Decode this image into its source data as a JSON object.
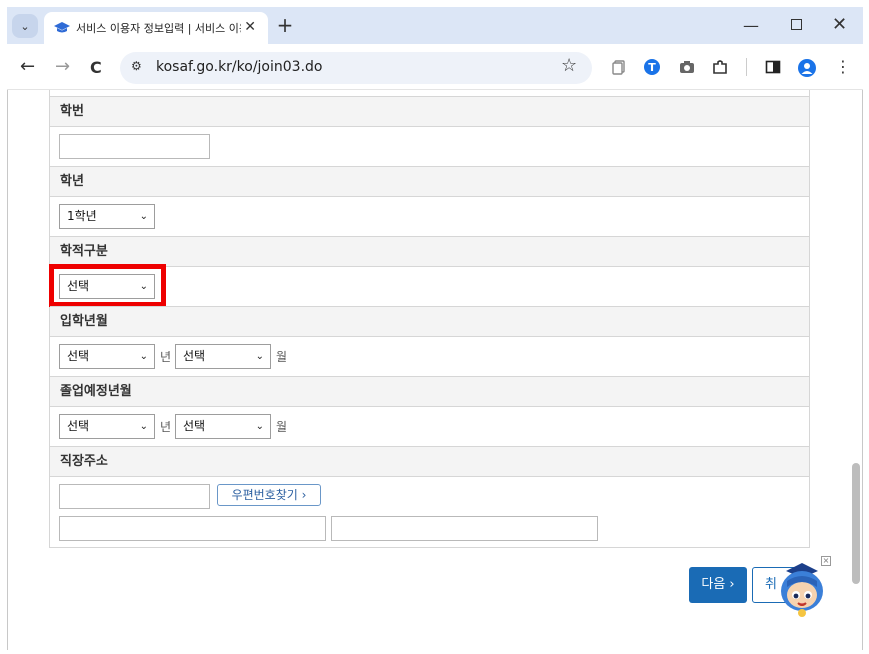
{
  "browser": {
    "tab_title": "서비스 이용자 정보입력 | 서비스 이용",
    "url": "kosaf.go.kr/ko/join03.do",
    "new_tab": "+",
    "back": "←",
    "forward": "→",
    "reload": "C",
    "minimize": "—",
    "close": "✕",
    "star": "☆",
    "tab_close": "✕",
    "tab_list": "⌄",
    "site_info_icon": "⚙",
    "extensions_icon": "puzzle-icon",
    "profile_icon": "avatar-icon"
  },
  "form": {
    "student_id": {
      "label": "학번",
      "value": ""
    },
    "grade": {
      "label": "학년",
      "selected": "1학년"
    },
    "status": {
      "label": "학적구분",
      "selected": "선택"
    },
    "admission": {
      "label": "입학년월",
      "year": "선택",
      "year_unit": "년",
      "month": "선택",
      "month_unit": "월"
    },
    "graduation": {
      "label": "졸업예정년월",
      "year": "선택",
      "year_unit": "년",
      "month": "선택",
      "month_unit": "월"
    },
    "work_address": {
      "label": "직장주소",
      "zip_button": "우편번호찾기 ›",
      "zip": "",
      "address1": "",
      "address2": ""
    }
  },
  "actions": {
    "next": "다음 ›",
    "cancel": "취"
  },
  "colors": {
    "highlight": "#ee0000",
    "primary": "#1a6bb5"
  }
}
